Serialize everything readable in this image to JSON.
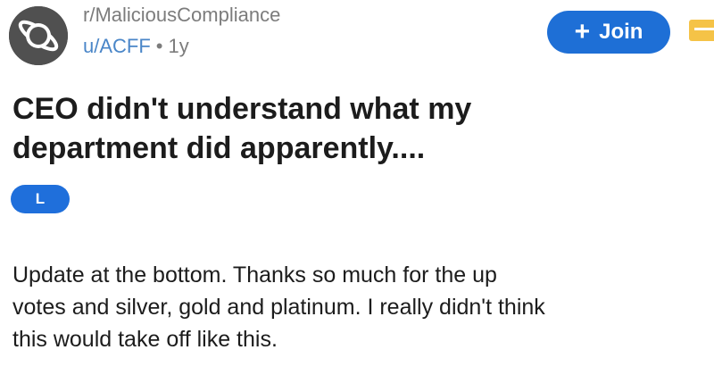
{
  "post": {
    "subreddit": "r/MaliciousCompliance",
    "author": "u/ACFF",
    "separator": "•",
    "age": "1y",
    "title_line1": "CEO didn't understand what my",
    "title_line2": "department did apparently....",
    "flair": "L",
    "body_line1": "Update at the bottom.  Thanks so much for the up",
    "body_line2": "votes and silver, gold and platinum. I really didn't think",
    "body_line3": "this would take off like this."
  },
  "actions": {
    "join_icon": "plus-icon",
    "join_label": "Join"
  },
  "icons": {
    "avatar": "planet-icon",
    "edge": "menu-icon"
  },
  "colors": {
    "accent": "#1e6fd6",
    "muted_text": "#7c7c7c",
    "user_link": "#4a86c8",
    "edge_icon": "#f5c347"
  }
}
